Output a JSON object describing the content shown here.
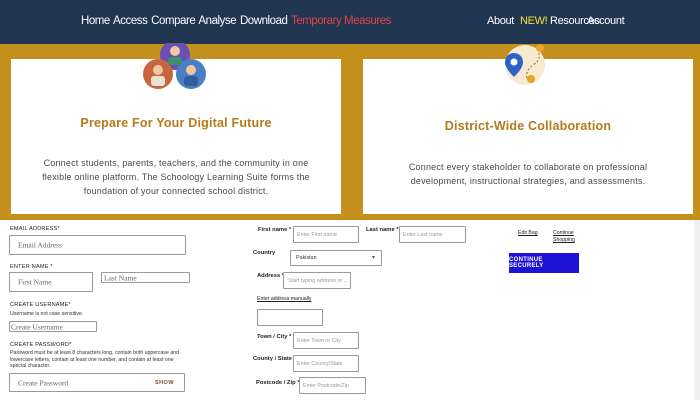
{
  "nav": {
    "left": [
      "Home",
      "Access",
      "Compare",
      "Analyse",
      "Download"
    ],
    "highlight": "Temporary Measures",
    "right": {
      "about": "About",
      "new_badge": "NEW!",
      "resources": "Resources",
      "account": "Account"
    }
  },
  "colors": {
    "nav_bg": "#1f3550",
    "hero_bg": "#c4901c",
    "title": "#b57a19",
    "highlight": "#e0454b",
    "new_badge": "#f3e23a",
    "button": "#1d12d6"
  },
  "cards": [
    {
      "title": "Prepare For Your Digital Future",
      "description": "Connect students, parents, teachers, and the community in one flexible online platform. The Schoology Learning Suite forms the foundation of your connected school district.",
      "icon": "people-illustration"
    },
    {
      "title": "District-Wide Collaboration",
      "description": "Connect every stakeholder to collaborate on professional development, instructional strategies, and assessments.",
      "icon": "map-pin-illustration"
    }
  ],
  "account_form": {
    "email_label": "EMAIL ADDRESS*",
    "email_placeholder": "Email Address",
    "name_label": "ENTER NAME *",
    "first_name_placeholder": "First Name",
    "last_name_placeholder": "Last Name",
    "username_label": "CREATE USERNAME*",
    "username_hint": "Username is not case sensitive.",
    "username_placeholder": "Create Username",
    "password_label": "CREATE PASSWORD*",
    "password_hint": "Password must be at least 8 characters long, contain both uppercase and lowercase letters, contain at least one number, and contain at least one special character.",
    "password_placeholder": "Create Password",
    "show_label": "SHOW"
  },
  "address_form": {
    "first_name_label": "First name *",
    "first_name_placeholder": "Enter First name",
    "last_name_label": "Last name *",
    "last_name_placeholder": "Enter Last name",
    "country_label": "Country",
    "country_value": "Pakistan",
    "address_label": "Address *",
    "address_placeholder": "Start typing address or ...",
    "manual_link": "Enter address manually",
    "town_label": "Town / City *",
    "town_placeholder": "Enter Town or City",
    "county_label": "County / State",
    "county_placeholder": "Enter County/State",
    "postcode_label": "Postcode / Zip *",
    "postcode_placeholder": "Enter Postcode/Zip"
  },
  "cart": {
    "edit_bag": "Edit Bag",
    "continue_shopping_1": "Continue",
    "continue_shopping_2": "Shopping",
    "continue_button": "CONTINUE SECURELY"
  }
}
